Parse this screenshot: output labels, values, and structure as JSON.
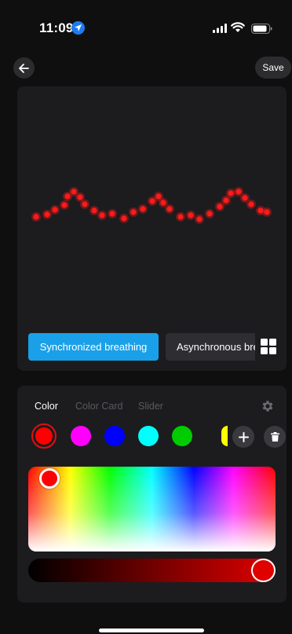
{
  "status_bar": {
    "time": "11:09",
    "icons": [
      "location-arrow-icon",
      "signal-icon",
      "wifi-icon",
      "battery-icon"
    ]
  },
  "nav": {
    "back_icon": "arrow-left-icon",
    "save_label": "Save"
  },
  "preview": {
    "light_color": "#ff1a1a",
    "modes": [
      {
        "label": "Synchronized breathing",
        "active": true
      },
      {
        "label": "Asynchronous breathing",
        "active": false
      }
    ],
    "grid_icon": "grid-icon"
  },
  "color_panel": {
    "tabs": [
      {
        "label": "Color",
        "active": true
      },
      {
        "label": "Color Card",
        "active": false
      },
      {
        "label": "Slider",
        "active": false
      }
    ],
    "settings_icon": "gear-icon",
    "swatches": [
      "#ff0000",
      "#ff00ff",
      "#0000ff",
      "#00ffff",
      "#00cc00",
      "#ffff00"
    ],
    "selected_swatch": "#ff0000",
    "add_icon": "plus-icon",
    "delete_icon": "trash-icon",
    "selected_color": "#ff0000",
    "brightness": 1.0
  }
}
